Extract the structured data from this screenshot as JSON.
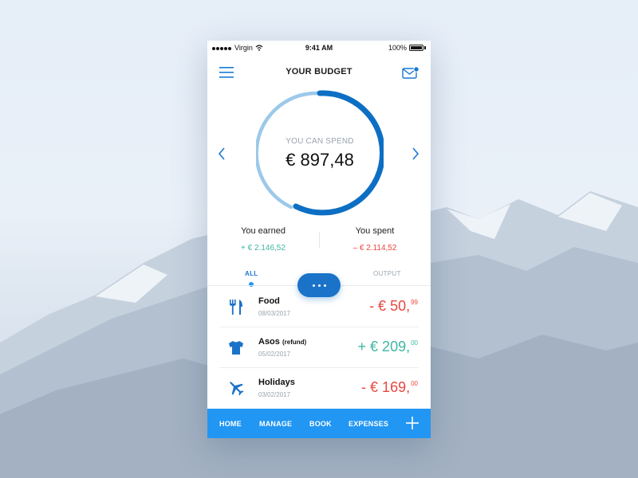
{
  "status_bar": {
    "carrier": "Virgin",
    "time": "9:41 AM",
    "battery": "100%"
  },
  "header": {
    "title": "YOUR BUDGET"
  },
  "budget": {
    "label": "YOU CAN SPEND",
    "amount": "€ 897,48"
  },
  "summary": {
    "earned_label": "You earned",
    "earned_value": "+ € 2.146,52",
    "spent_label": "You spent",
    "spent_value": "– € 2.114,52"
  },
  "tabs": {
    "all": "ALL",
    "output": "OUTPUT"
  },
  "transactions": [
    {
      "name": "Food",
      "note": "",
      "date": "08/03/2017",
      "amount_main": "- € 50,",
      "amount_cents": "99",
      "type": "expense",
      "icon": "cutlery-icon"
    },
    {
      "name": "Asos",
      "note": "(refund)",
      "date": "05/02/2017",
      "amount_main": "+ € 209,",
      "amount_cents": "00",
      "type": "income",
      "icon": "tshirt-icon"
    },
    {
      "name": "Holidays",
      "note": "",
      "date": "03/02/2017",
      "amount_main": "- € 169,",
      "amount_cents": "00",
      "type": "expense",
      "icon": "airplane-icon"
    }
  ],
  "bottom_nav": {
    "home": "HOME",
    "manage": "MANAGE",
    "book": "BOOK",
    "expenses": "EXPENSES"
  },
  "colors": {
    "accent": "#2196f3",
    "accent_dark": "#1a73c8",
    "income": "#3fb6a2",
    "expense": "#e9473f"
  }
}
